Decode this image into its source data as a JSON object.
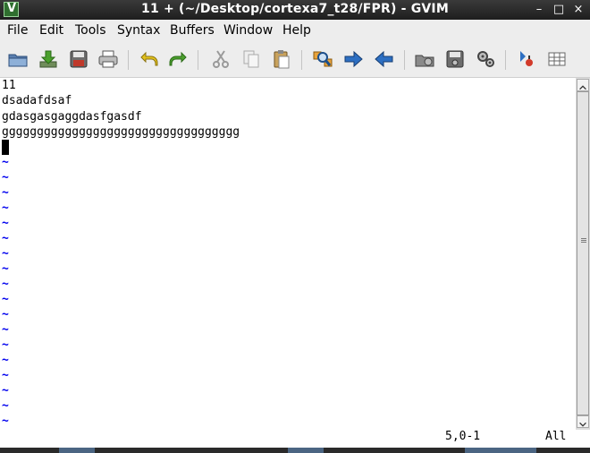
{
  "window": {
    "title": "11 + (~/Desktop/cortexa7_t28/FPR) - GVIM",
    "controls": {
      "minimize": "–",
      "maximize": "□",
      "close": "×"
    }
  },
  "menubar": {
    "items": [
      "File",
      "Edit",
      "Tools",
      "Syntax",
      "Buffers",
      "Window",
      "Help"
    ]
  },
  "toolbar": {
    "buttons": [
      "open-folder-icon",
      "download-icon",
      "save-icon",
      "print-icon",
      "undo-icon",
      "redo-icon",
      "cut-icon",
      "copy-icon",
      "paste-icon",
      "find-replace-icon",
      "forward-icon",
      "back-icon",
      "load-session-icon",
      "save-session-icon",
      "run-script-icon",
      "make-icon",
      "table-icon"
    ]
  },
  "editor": {
    "lines": [
      "11",
      "dsadafdsaf",
      "gdasgasgaggdasfgasdf",
      "gggggggggggggggggggggggggggggggggg",
      ""
    ],
    "empty_line_marker": "~",
    "marker_count": 18,
    "colors": {
      "marker": "#0000ee",
      "text": "#000000"
    }
  },
  "statusline": {
    "ruler": "5,0-1",
    "position": "All"
  }
}
